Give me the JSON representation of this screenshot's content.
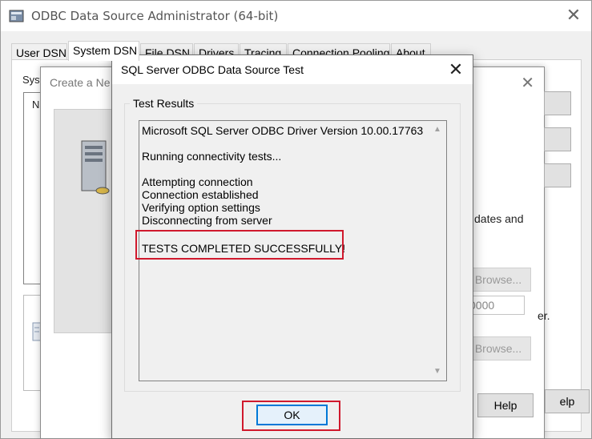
{
  "main_window": {
    "title": "ODBC Data Source Administrator (64-bit)",
    "tabs": [
      {
        "label": "User DSN",
        "active": false
      },
      {
        "label": "System DSN",
        "active": true
      },
      {
        "label": "File DSN",
        "active": false
      },
      {
        "label": "Drivers",
        "active": false
      },
      {
        "label": "Tracing",
        "active": false
      },
      {
        "label": "Connection Pooling",
        "active": false
      },
      {
        "label": "About",
        "active": false
      }
    ],
    "partial_labels": {
      "system": "Syst",
      "name": "Na"
    }
  },
  "wizard_window": {
    "title": "Create a Ne",
    "partial_texts": {
      "updates": "dates and",
      "er": "er.",
      "value": "0000",
      "browse1": "Browse...",
      "browse2": "Browse...",
      "help": "Help",
      "help_partial": "elp"
    }
  },
  "test_dialog": {
    "title": "SQL Server ODBC Data Source Test",
    "group_label": "Test Results",
    "lines": [
      "Microsoft SQL Server ODBC Driver Version 10.00.17763",
      "",
      "Running connectivity tests...",
      "",
      "Attempting connection",
      "Connection established",
      "Verifying option settings",
      "Disconnecting from server",
      "",
      "TESTS COMPLETED SUCCESSFULLY!"
    ],
    "ok_label": "OK"
  },
  "colors": {
    "highlight": "#d0192d",
    "focus_border": "#0078d7"
  }
}
